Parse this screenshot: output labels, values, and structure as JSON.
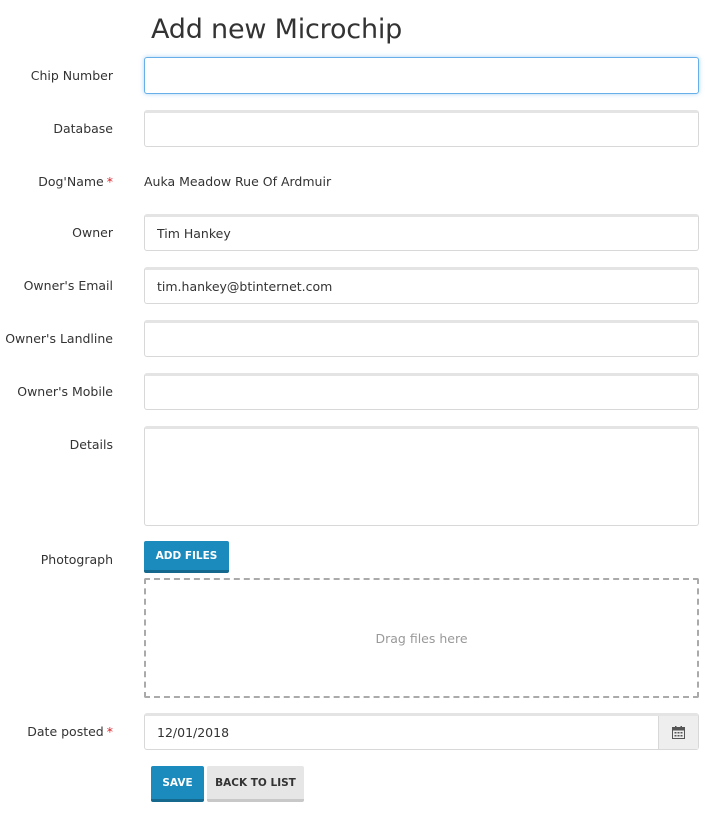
{
  "page": {
    "title": "Add new Microchip"
  },
  "form": {
    "chip_number": {
      "label": "Chip Number",
      "value": ""
    },
    "database": {
      "label": "Database",
      "value": ""
    },
    "dog_name": {
      "label": "Dog'Name",
      "required_mark": "*",
      "value": "Auka Meadow Rue Of Ardmuir"
    },
    "owner": {
      "label": "Owner",
      "value": "Tim Hankey"
    },
    "owner_email": {
      "label": "Owner's Email",
      "value": "tim.hankey@btinternet.com"
    },
    "owner_landline": {
      "label": "Owner's Landline",
      "value": ""
    },
    "owner_mobile": {
      "label": "Owner's Mobile",
      "value": ""
    },
    "details": {
      "label": "Details",
      "value": ""
    },
    "photograph": {
      "label": "Photograph",
      "add_files_label": "ADD FILES",
      "dropzone_text": "Drag files here"
    },
    "date_posted": {
      "label": "Date posted",
      "required_mark": "*",
      "value": "12/01/2018",
      "icon": "calendar-icon"
    }
  },
  "actions": {
    "save_label": "SAVE",
    "back_label": "BACK TO LIST"
  },
  "colors": {
    "primary": "#1b8bbd",
    "required": "#d9242b",
    "focus": "#66afe9"
  }
}
